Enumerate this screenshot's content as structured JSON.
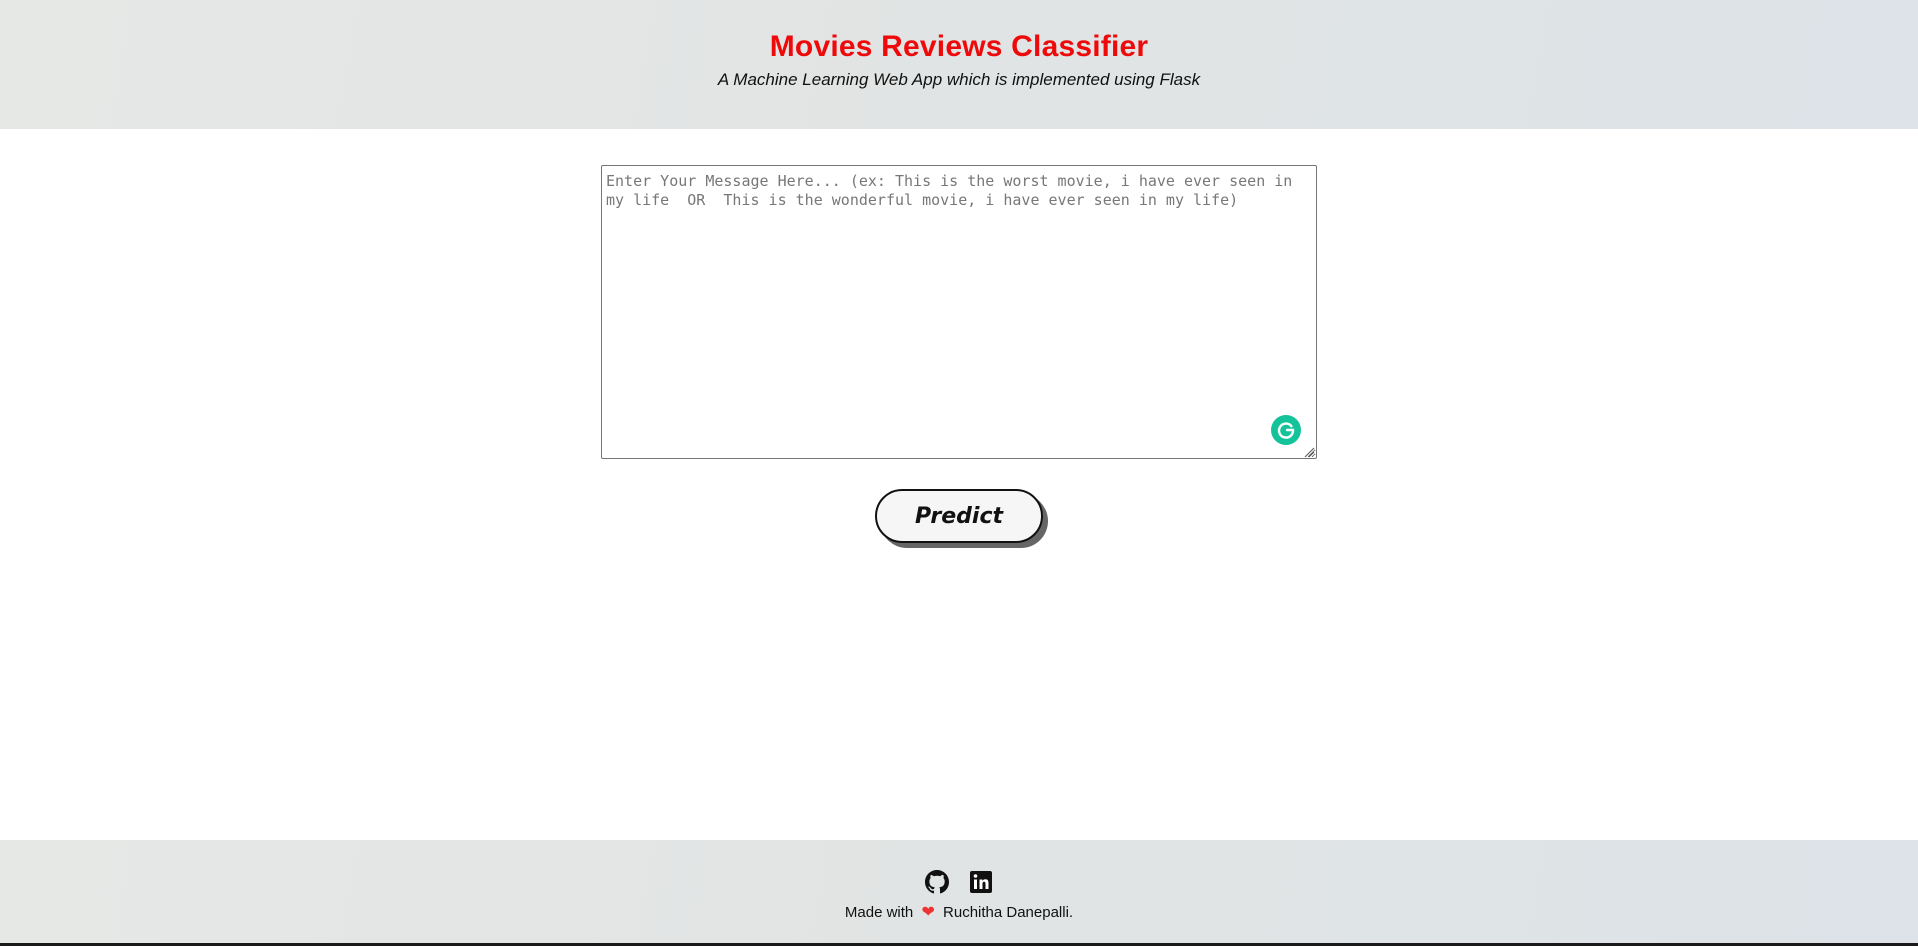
{
  "header": {
    "title": "Movies Reviews Classifier",
    "subtitle": "A Machine Learning Web App which is implemented using Flask"
  },
  "form": {
    "message_placeholder": "Enter Your Message Here... (ex: This is the worst movie, i have ever seen in my life  OR  This is the wonderful movie, i have ever seen in my life)",
    "message_value": "",
    "predict_label": "Predict"
  },
  "footer": {
    "made_with": "Made with",
    "heart_icon": "heart-icon",
    "author": "Ruchitha Danepalli.",
    "links": [
      {
        "icon": "github-icon"
      },
      {
        "icon": "linkedin-icon"
      }
    ]
  },
  "colors": {
    "title": "#ee0a0a",
    "heart": "#ee3333",
    "grammarly": "#15c39a"
  }
}
